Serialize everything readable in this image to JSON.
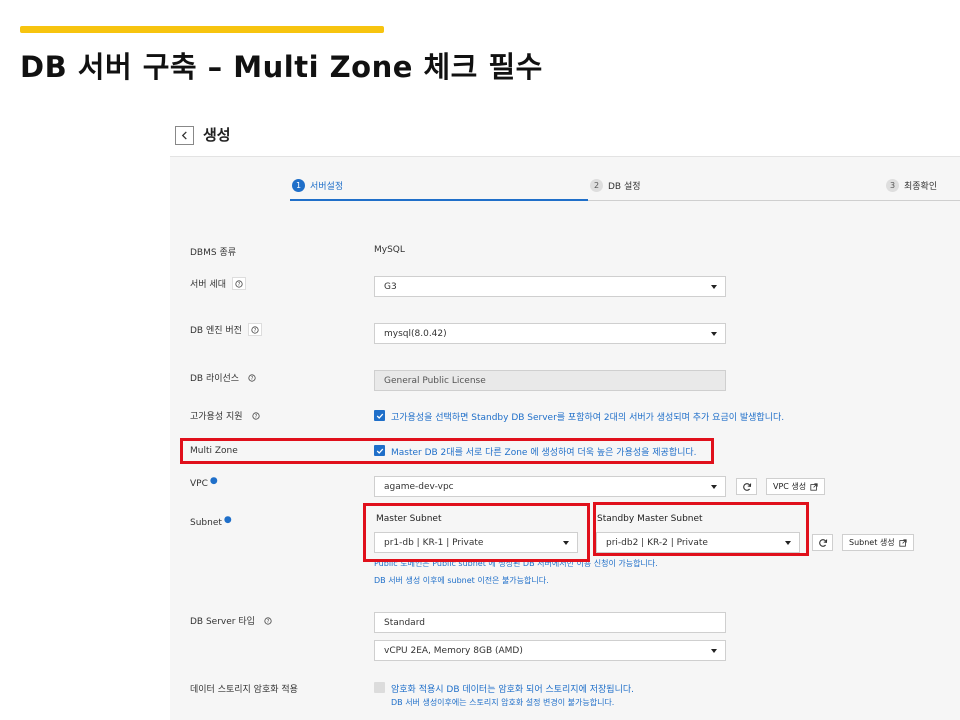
{
  "slide": {
    "title": "DB 서버 구축 – Multi Zone 체크 필수"
  },
  "page": {
    "title": "생성"
  },
  "steps": [
    {
      "num": "1",
      "label": "서버설정"
    },
    {
      "num": "2",
      "label": "DB 설정"
    },
    {
      "num": "3",
      "label": "최종확인"
    }
  ],
  "form": {
    "dbms": {
      "label": "DBMS 종류",
      "value": "MySQL"
    },
    "server_gen": {
      "label": "서버 세대",
      "value": "G3"
    },
    "engine_version": {
      "label": "DB 엔진 버전",
      "value": "mysql(8.0.42)"
    },
    "license": {
      "label": "DB 라이선스",
      "value": "General Public License"
    },
    "ha": {
      "label": "고가용성 지원",
      "text": "고가용성을 선택하면 Standby DB Server를 포함하여 2대의 서버가 생성되며 추가 요금이 발생합니다."
    },
    "multi_zone": {
      "label": "Multi Zone",
      "text": "Master DB 2대를 서로 다른 Zone 에 생성하여 더욱 높은 가용성을 제공합니다."
    },
    "vpc": {
      "label": "VPC",
      "value": "agame-dev-vpc",
      "create_label": "VPC 생성"
    },
    "subnet": {
      "label": "Subnet",
      "master_title": "Master Subnet",
      "master_value": "pr1-db | KR-1 | Private",
      "standby_title": "Standby Master Subnet",
      "standby_value": "pri-db2 | KR-2 | Private",
      "create_label": "Subnet 생성",
      "note1": "Public 도메인은 Public subnet 에 생성된 DB 서버에서만 이용 신청이 가능합니다.",
      "note2": "DB 서버 생성 이후에 subnet 이전은 불가능합니다."
    },
    "server_type": {
      "label": "DB Server 타입",
      "value": "Standard",
      "spec": "vCPU 2EA, Memory 8GB (AMD)"
    },
    "encryption": {
      "label": "데이터 스토리지 암호화 적용",
      "text1": "암호화 적용시 DB 데이터는 암호화 되어 스토리지에 저장됩니다.",
      "text2": "DB 서버 생성이후에는 스토리지 암호화 설정 변경이 불가능합니다."
    }
  },
  "colors": {
    "accent_yellow": "#f7c40f",
    "primary_blue": "#1f6fc9",
    "highlight_red": "#e0101b"
  }
}
